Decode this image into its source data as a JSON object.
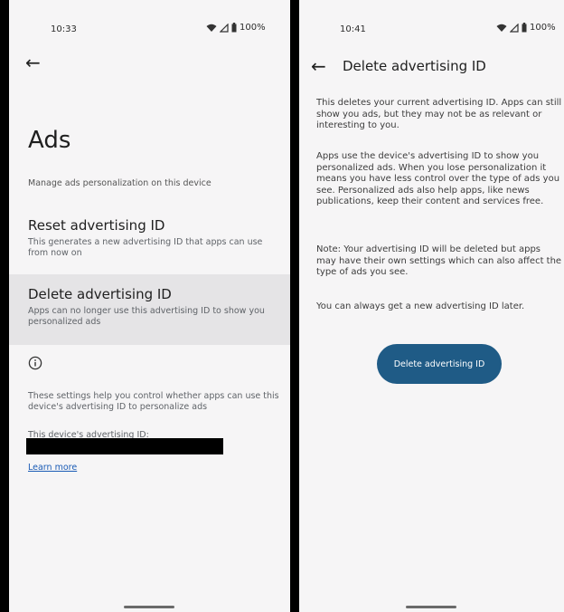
{
  "left_screen": {
    "status_time": "10:33",
    "battery": "100%",
    "title": "Ads",
    "subtitle": "Manage ads personalization on this device",
    "items": [
      {
        "title": "Reset advertising ID",
        "summary": "This generates a new advertising ID that apps can use from now on"
      },
      {
        "title": "Delete advertising ID",
        "summary": "Apps can no longer use this advertising ID to show you personalized ads"
      }
    ],
    "info_text": "These settings help you control whether apps can use this device's advertising ID to personalize ads",
    "id_label": "This device's advertising ID:",
    "learn_more": "Learn more"
  },
  "right_screen": {
    "status_time": "10:41",
    "battery": "100%",
    "title": "Delete advertising ID",
    "paragraphs": [
      "This deletes your current advertising ID. Apps can still show you ads, but they may not be as relevant or interesting to you.",
      "Apps use the device's advertising ID to show you personalized ads. When you lose personalization it means you have less control over the type of ads you see. Personalized ads also help apps, like news publications, keep their content and services free.",
      "Note: Your advertising ID will be deleted but apps may have their own settings which can also affect the type of ads you see.",
      "You can always get a new advertising ID later."
    ],
    "button_label": "Delete advertising ID"
  },
  "icons": [
    "wifi-icon",
    "signal-icon",
    "battery-icon",
    "back-arrow-icon",
    "info-icon"
  ],
  "colors": {
    "accent_button": "#1f5b86",
    "link": "#1a5bb5",
    "selected_row": "#e5e4e6",
    "background": "#f6f5f6"
  }
}
